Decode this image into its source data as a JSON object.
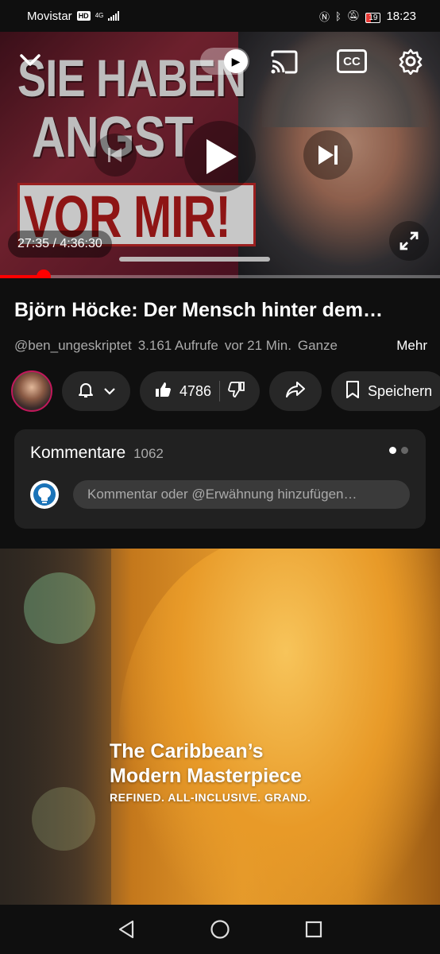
{
  "status_bar": {
    "carrier": "Movistar",
    "hd_badge": "HD",
    "network": "4G",
    "battery": "19",
    "time": "18:23"
  },
  "video": {
    "thumbnail_text": [
      "SIE HABEN",
      "ANGST",
      "VOR MIR!"
    ],
    "time_display": "27:35 / 4:36:30",
    "progress_fraction": 0.1,
    "autoplay_on": true,
    "cc_label": "CC"
  },
  "info": {
    "title": "Björn Höcke: Der Mensch hinter dem…",
    "channel_handle": "@ben_ungeskriptet",
    "views": "3.161 Aufrufe",
    "age": "vor 21 Min.",
    "desc_preview": "Ganze",
    "more_label": "Mehr"
  },
  "actions": {
    "like_count": "4786",
    "save_label": "Speichern"
  },
  "comments": {
    "heading": "Kommentare",
    "count": "1062",
    "placeholder": "Kommentar oder @Erwähnung hinzufügen…"
  },
  "ad": {
    "headline_line1": "The Caribbean’s",
    "headline_line2": "Modern Masterpiece",
    "tagline": "REFINED. ALL-INCLUSIVE. GRAND."
  },
  "colors": {
    "accent_red": "#ff0000",
    "background": "#0f0f0f",
    "surface": "#212121",
    "pill": "#272727"
  }
}
